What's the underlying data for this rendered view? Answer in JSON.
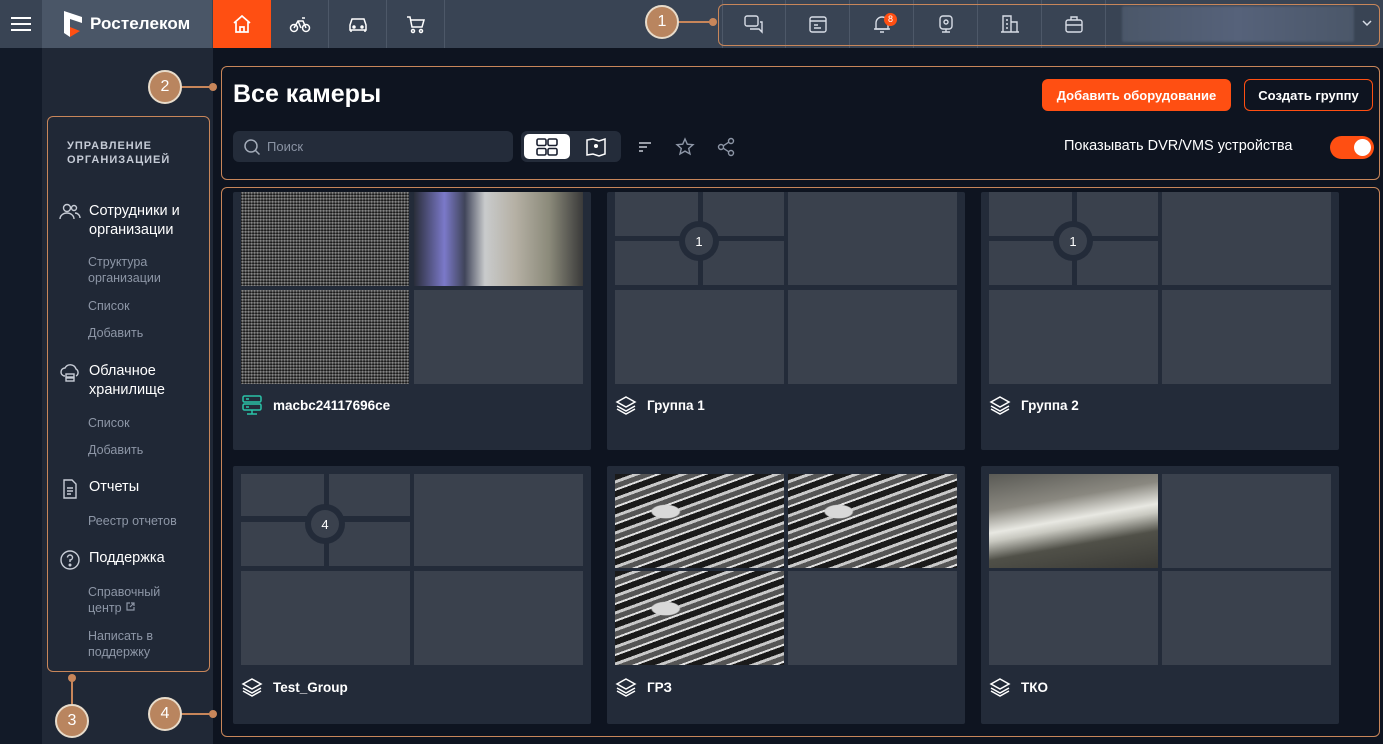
{
  "topbar": {
    "logo_text": "Ростелеком",
    "nav_icons": [
      "home-icon",
      "bike-icon",
      "car-icon",
      "cart-icon"
    ],
    "right_icons": [
      "chat-icon",
      "calendar-icon",
      "bell-icon",
      "webcam-icon",
      "building-icon",
      "briefcase-icon"
    ],
    "notification_count": "8"
  },
  "sidebar": {
    "heading_line1": "УПРАВЛЕНИЕ",
    "heading_line2": "ОРГАНИЗАЦИЕЙ",
    "sections": [
      {
        "title": "Сотрудники и организации",
        "icon": "users-icon",
        "items": [
          "Структура организации",
          "Список",
          "Добавить"
        ]
      },
      {
        "title": "Облачное хранилище",
        "icon": "cloud-storage-icon",
        "items": [
          "Список",
          "Добавить"
        ]
      },
      {
        "title": "Отчеты",
        "icon": "document-icon",
        "items": [
          "Реестр отчетов"
        ]
      },
      {
        "title": "Поддержка",
        "icon": "help-icon",
        "items": [
          "Справочный центр",
          "Написать в поддержку"
        ]
      }
    ]
  },
  "header": {
    "title": "Все камеры",
    "add_button": "Добавить оборудование",
    "create_group_button": "Создать группу",
    "search_placeholder": "Поиск",
    "dvr_toggle_label": "Показывать DVR/VMS устройства",
    "dvr_toggle_on": true
  },
  "cards": [
    {
      "name": "macbc24117696ce",
      "icon": "dvr-device-icon",
      "count": ""
    },
    {
      "name": "Группа 1",
      "icon": "layers-icon",
      "count": "1"
    },
    {
      "name": "Группа 2",
      "icon": "layers-icon",
      "count": "1"
    },
    {
      "name": "Test_Group",
      "icon": "layers-icon",
      "count": "4"
    },
    {
      "name": "ГРЗ",
      "icon": "layers-icon",
      "count": ""
    },
    {
      "name": "ТКО",
      "icon": "layers-icon",
      "count": ""
    }
  ],
  "annotations": [
    "1",
    "2",
    "3",
    "4"
  ],
  "colors": {
    "accent": "#ff4f12",
    "annotation": "#c8865a",
    "background": "#0e1420",
    "card": "#232b39"
  }
}
